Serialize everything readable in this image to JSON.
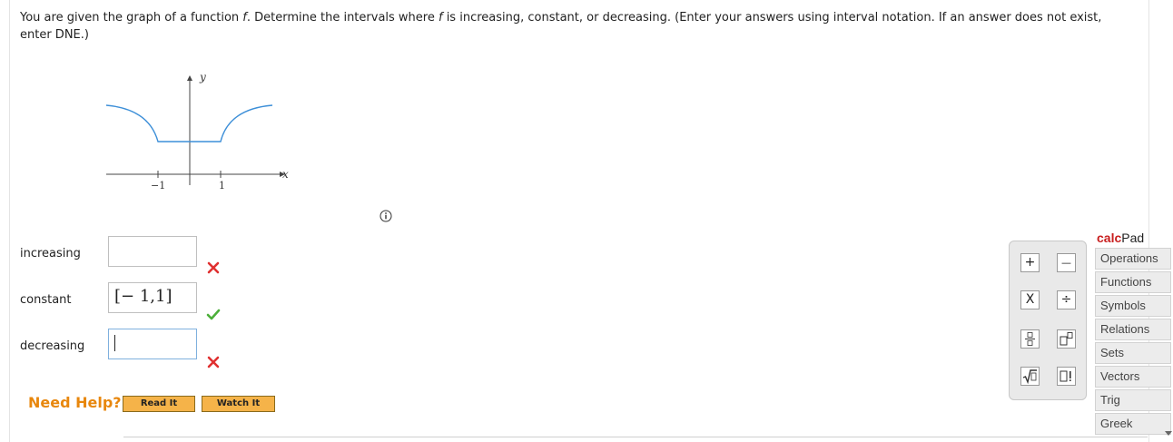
{
  "question": {
    "text_before": "You are given the graph of a function ",
    "f1": "f",
    "text_mid": ". Determine the intervals where ",
    "f2": "f",
    "text_after": " is increasing, constant, or decreasing. (Enter your answers using interval notation. If an answer does not exist, enter DNE.)"
  },
  "graph": {
    "y_label": "y",
    "x_label": "x",
    "tick_neg": "−1",
    "tick_pos": "1",
    "curve_color": "#3d8fd8"
  },
  "rows": {
    "increasing": {
      "label": "increasing",
      "value": "",
      "status": "incorrect"
    },
    "constant": {
      "label": "constant",
      "value": "[− 1,1]",
      "status": "correct"
    },
    "decreasing": {
      "label": "decreasing",
      "value": "",
      "status": "incorrect"
    }
  },
  "help": {
    "need_help": "Need Help?",
    "read_it": "Read It",
    "watch_it": "Watch It"
  },
  "calcpad": {
    "title_calc": "calc",
    "title_pad": "Pad",
    "tabs": [
      "Operations",
      "Functions",
      "Symbols",
      "Relations",
      "Sets",
      "Vectors",
      "Trig",
      "Greek"
    ],
    "buttons": {
      "plus": "+",
      "minus": "—",
      "times": "X",
      "divide": "÷",
      "fraction": "fraction-icon",
      "exponent": "exponent-icon",
      "sqrt": "sqrt-icon",
      "factorial": "factorial-icon"
    }
  },
  "colors": {
    "incorrect": "#e03030",
    "correct": "#4caf3a",
    "need_help": "#e8870d",
    "button_bg": "#f5b349"
  }
}
